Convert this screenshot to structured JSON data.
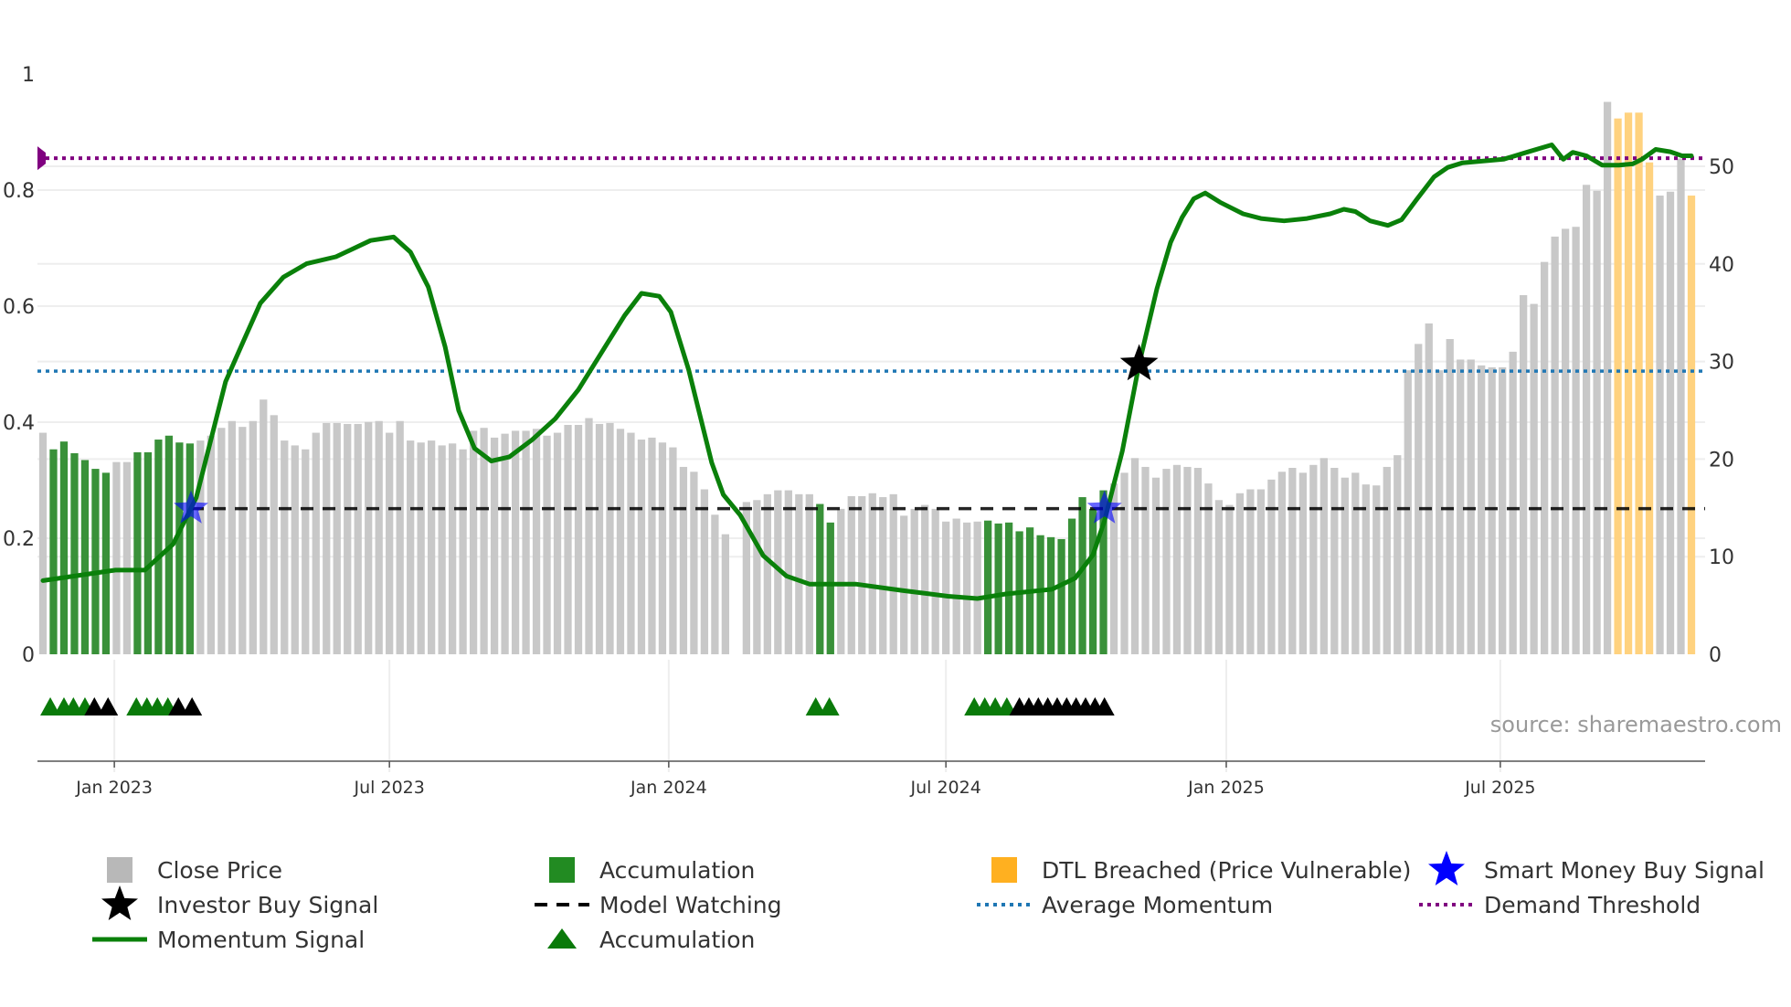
{
  "chart_data": {
    "type": "bar",
    "title": "",
    "source": "source: sharemaestro.com",
    "left_axis": {
      "ylim": [
        0,
        1
      ],
      "ticks": [
        "0",
        "0.2",
        "0.4",
        "0.6",
        "0.8",
        "1"
      ],
      "tick_values": [
        0,
        0.2,
        0.4,
        0.6,
        0.8,
        1
      ]
    },
    "right_axis": {
      "ylim": [
        0,
        59.5
      ],
      "ticks": [
        "0",
        "10",
        "20",
        "30",
        "40",
        "50"
      ],
      "tick_values": [
        0,
        10,
        20,
        30,
        40,
        50
      ]
    },
    "x_ticks": [
      {
        "label": "Jan 2023",
        "week": 6.8
      },
      {
        "label": "Jul 2023",
        "week": 33.0
      },
      {
        "label": "Jan 2024",
        "week": 59.6
      },
      {
        "label": "Jul 2024",
        "week": 86.0
      },
      {
        "label": "Jan 2025",
        "week": 112.7
      },
      {
        "label": "Jul 2025",
        "week": 138.8
      }
    ],
    "close_price": [
      22.7,
      21.0,
      21.8,
      20.6,
      19.9,
      19.0,
      18.6,
      19.7,
      19.7,
      20.7,
      20.7,
      22.0,
      22.4,
      21.7,
      21.6,
      21.9,
      22.4,
      23.2,
      23.9,
      23.3,
      23.9,
      26.1,
      24.5,
      21.9,
      21.4,
      21.0,
      22.7,
      23.7,
      23.7,
      23.6,
      23.6,
      23.8,
      23.9,
      22.7,
      23.9,
      21.9,
      21.7,
      21.9,
      21.4,
      21.6,
      21.0,
      22.9,
      23.2,
      22.2,
      22.6,
      22.9,
      22.9,
      23.1,
      22.4,
      22.7,
      23.5,
      23.5,
      24.2,
      23.6,
      23.7,
      23.1,
      22.7,
      22.0,
      22.2,
      21.7,
      21.2,
      19.2,
      18.7,
      16.9,
      14.3,
      12.3,
      null,
      15.6,
      15.8,
      16.4,
      16.8,
      16.8,
      16.4,
      16.4,
      15.4,
      13.5,
      14.9,
      16.2,
      16.2,
      16.5,
      16.1,
      16.4,
      14.2,
      14.9,
      15.3,
      14.9,
      13.6,
      13.9,
      13.5,
      13.6,
      13.7,
      13.4,
      13.5,
      12.6,
      13.0,
      12.2,
      12.0,
      11.8,
      13.9,
      16.1,
      14.9,
      16.8,
      17.5,
      18.6,
      20.1,
      19.2,
      18.1,
      19.0,
      19.4,
      19.2,
      19.1,
      17.5,
      15.8,
      15.3,
      16.5,
      16.9,
      16.9,
      17.9,
      18.7,
      19.1,
      18.6,
      19.4,
      20.1,
      19.1,
      18.1,
      18.6,
      17.4,
      17.3,
      19.2,
      20.4,
      29.1,
      31.8,
      33.9,
      29.1,
      32.3,
      30.2,
      30.2,
      29.6,
      29.4,
      29.4,
      31.0,
      36.8,
      35.9,
      40.2,
      42.8,
      43.6,
      43.8,
      48.1,
      47.5,
      56.6,
      54.9,
      55.5,
      55.5,
      50.4,
      47.0,
      47.4,
      50.8,
      47.0
    ],
    "bar_status": "nggggggnnggggggnnnnnnnnnnnnnnnnnnnnnnnnnnnnnnnnnnnnnnnnnnnnnnnnnnnnnnnnnnnggnnnnnnnnnnnnnnggggggggggggnnnnnnnnnnnnnnnnnnnnnnnnnnnnnnnnnnnnnnnnnnnnnnnnoooonnnon",
    "momentum_signal": [
      [
        0,
        0.127
      ],
      [
        6.9,
        0.145
      ],
      [
        9.7,
        0.145
      ],
      [
        12.4,
        0.19
      ],
      [
        14.6,
        0.27
      ],
      [
        17.4,
        0.47
      ],
      [
        19.1,
        0.54
      ],
      [
        20.7,
        0.605
      ],
      [
        22.9,
        0.65
      ],
      [
        25.1,
        0.673
      ],
      [
        27.9,
        0.685
      ],
      [
        31.2,
        0.713
      ],
      [
        33.4,
        0.719
      ],
      [
        35.0,
        0.693
      ],
      [
        36.7,
        0.633
      ],
      [
        38.3,
        0.53
      ],
      [
        39.6,
        0.42
      ],
      [
        41.1,
        0.355
      ],
      [
        42.7,
        0.333
      ],
      [
        44.4,
        0.34
      ],
      [
        46.6,
        0.37
      ],
      [
        48.8,
        0.406
      ],
      [
        51.0,
        0.456
      ],
      [
        53.2,
        0.52
      ],
      [
        55.4,
        0.584
      ],
      [
        57.0,
        0.622
      ],
      [
        58.7,
        0.617
      ],
      [
        59.8,
        0.59
      ],
      [
        61.5,
        0.49
      ],
      [
        63.7,
        0.33
      ],
      [
        64.8,
        0.275
      ],
      [
        66.4,
        0.24
      ],
      [
        68.6,
        0.17
      ],
      [
        70.8,
        0.135
      ],
      [
        73.0,
        0.121
      ],
      [
        77.4,
        0.121
      ],
      [
        81.8,
        0.11
      ],
      [
        86.2,
        0.1
      ],
      [
        89.0,
        0.096
      ],
      [
        91.7,
        0.104
      ],
      [
        96.1,
        0.112
      ],
      [
        98.3,
        0.131
      ],
      [
        100.0,
        0.171
      ],
      [
        101.1,
        0.23
      ],
      [
        102.8,
        0.35
      ],
      [
        104.4,
        0.5
      ],
      [
        106.1,
        0.63
      ],
      [
        107.4,
        0.71
      ],
      [
        108.5,
        0.753
      ],
      [
        109.6,
        0.785
      ],
      [
        110.7,
        0.795
      ],
      [
        112.1,
        0.779
      ],
      [
        114.3,
        0.759
      ],
      [
        116.0,
        0.751
      ],
      [
        118.2,
        0.747
      ],
      [
        120.4,
        0.751
      ],
      [
        122.6,
        0.759
      ],
      [
        123.9,
        0.767
      ],
      [
        125.0,
        0.763
      ],
      [
        126.4,
        0.747
      ],
      [
        128.1,
        0.739
      ],
      [
        129.4,
        0.749
      ],
      [
        130.8,
        0.783
      ],
      [
        132.5,
        0.823
      ],
      [
        133.8,
        0.839
      ],
      [
        135.2,
        0.847
      ],
      [
        139.1,
        0.853
      ],
      [
        141.3,
        0.865
      ],
      [
        143.7,
        0.878
      ],
      [
        144.8,
        0.853
      ],
      [
        145.7,
        0.865
      ],
      [
        147.0,
        0.859
      ],
      [
        148.5,
        0.843
      ],
      [
        150.1,
        0.843
      ],
      [
        151.4,
        0.845
      ],
      [
        152.3,
        0.853
      ],
      [
        153.6,
        0.87
      ],
      [
        155.0,
        0.866
      ],
      [
        156.1,
        0.859
      ],
      [
        157,
        0.859
      ]
    ],
    "demand_threshold": 0.855,
    "average_momentum": 0.488,
    "model_watching": 0.251,
    "investor_buy_signals": [
      [
        104.4,
        0.5
      ]
    ],
    "smart_money_buy_signals": [
      [
        14.1,
        0.251
      ],
      [
        101.1,
        0.251
      ]
    ],
    "accumulation_markers_green": [
      0.7,
      2.0,
      2.9,
      4.0,
      8.9,
      9.9,
      10.9,
      11.9,
      73.6,
      74.9,
      88.7,
      89.7,
      90.7,
      91.8
    ],
    "accumulation_markers_black": [
      4.9,
      6.2,
      12.9,
      14.2,
      93.0,
      93.9,
      94.8,
      95.7,
      96.6,
      97.5,
      98.4,
      99.3,
      100.2,
      101.1
    ],
    "colors": {
      "close": "#c8c8c8",
      "accum": "#2e8b2e",
      "dtl": "#ffd27f",
      "momentum": "#0a800a",
      "avg": "#1f77b4",
      "demand": "#800080",
      "smart": "#0000ff"
    },
    "legend": [
      {
        "label": "Close Price",
        "icon": "square-gray"
      },
      {
        "label": "Accumulation",
        "icon": "square-green"
      },
      {
        "label": "DTL Breached (Price Vulnerable)",
        "icon": "square-orange"
      },
      {
        "label": "Smart Money Buy Signal",
        "icon": "star-blue"
      },
      {
        "label": "Investor Buy Signal",
        "icon": "star-black"
      },
      {
        "label": "Model Watching",
        "icon": "dash-black"
      },
      {
        "label": "Average Momentum",
        "icon": "dot-blue"
      },
      {
        "label": "Demand Threshold",
        "icon": "dot-purple"
      },
      {
        "label": "Momentum Signal",
        "icon": "line-green"
      },
      {
        "label": "Accumulation",
        "icon": "triangle-green"
      }
    ]
  }
}
